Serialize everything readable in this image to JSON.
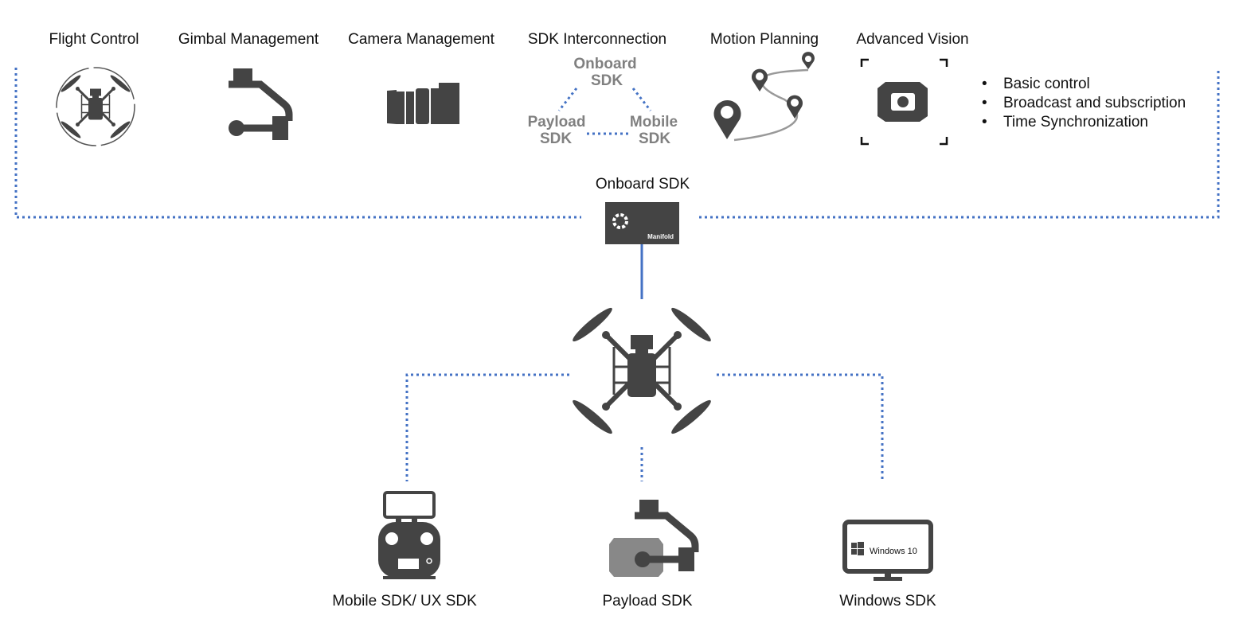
{
  "features": [
    {
      "label": "Flight Control",
      "icon": "drone-icon"
    },
    {
      "label": "Gimbal Management",
      "icon": "gimbal-icon"
    },
    {
      "label": "Camera Management",
      "icon": "camera-lens-icon"
    },
    {
      "label": "SDK Interconnection",
      "icon": "sdk-triangle"
    },
    {
      "label": "Motion Planning",
      "icon": "map-pins-icon"
    },
    {
      "label": "Advanced Vision",
      "icon": "vision-camera-icon"
    }
  ],
  "interconnection": {
    "onboard": [
      "Onboard",
      "SDK"
    ],
    "payload": [
      "Payload",
      "SDK"
    ],
    "mobile": [
      "Mobile",
      "SDK"
    ]
  },
  "bullets": [
    "Basic control",
    "Broadcast and subscription",
    "Time Synchronization"
  ],
  "onboard": {
    "label": "Onboard SDK",
    "device_text": "Manifold"
  },
  "bottom": [
    {
      "label": "Mobile SDK/ UX SDK",
      "icon": "remote-controller-icon"
    },
    {
      "label": "Payload SDK",
      "icon": "payload-gimbal-icon"
    },
    {
      "label": "Windows SDK",
      "icon": "monitor-icon",
      "screen_text": "Windows 10"
    }
  ],
  "colors": {
    "connector": "#4472c4",
    "icon": "#444444",
    "secondary_text": "#808080"
  }
}
